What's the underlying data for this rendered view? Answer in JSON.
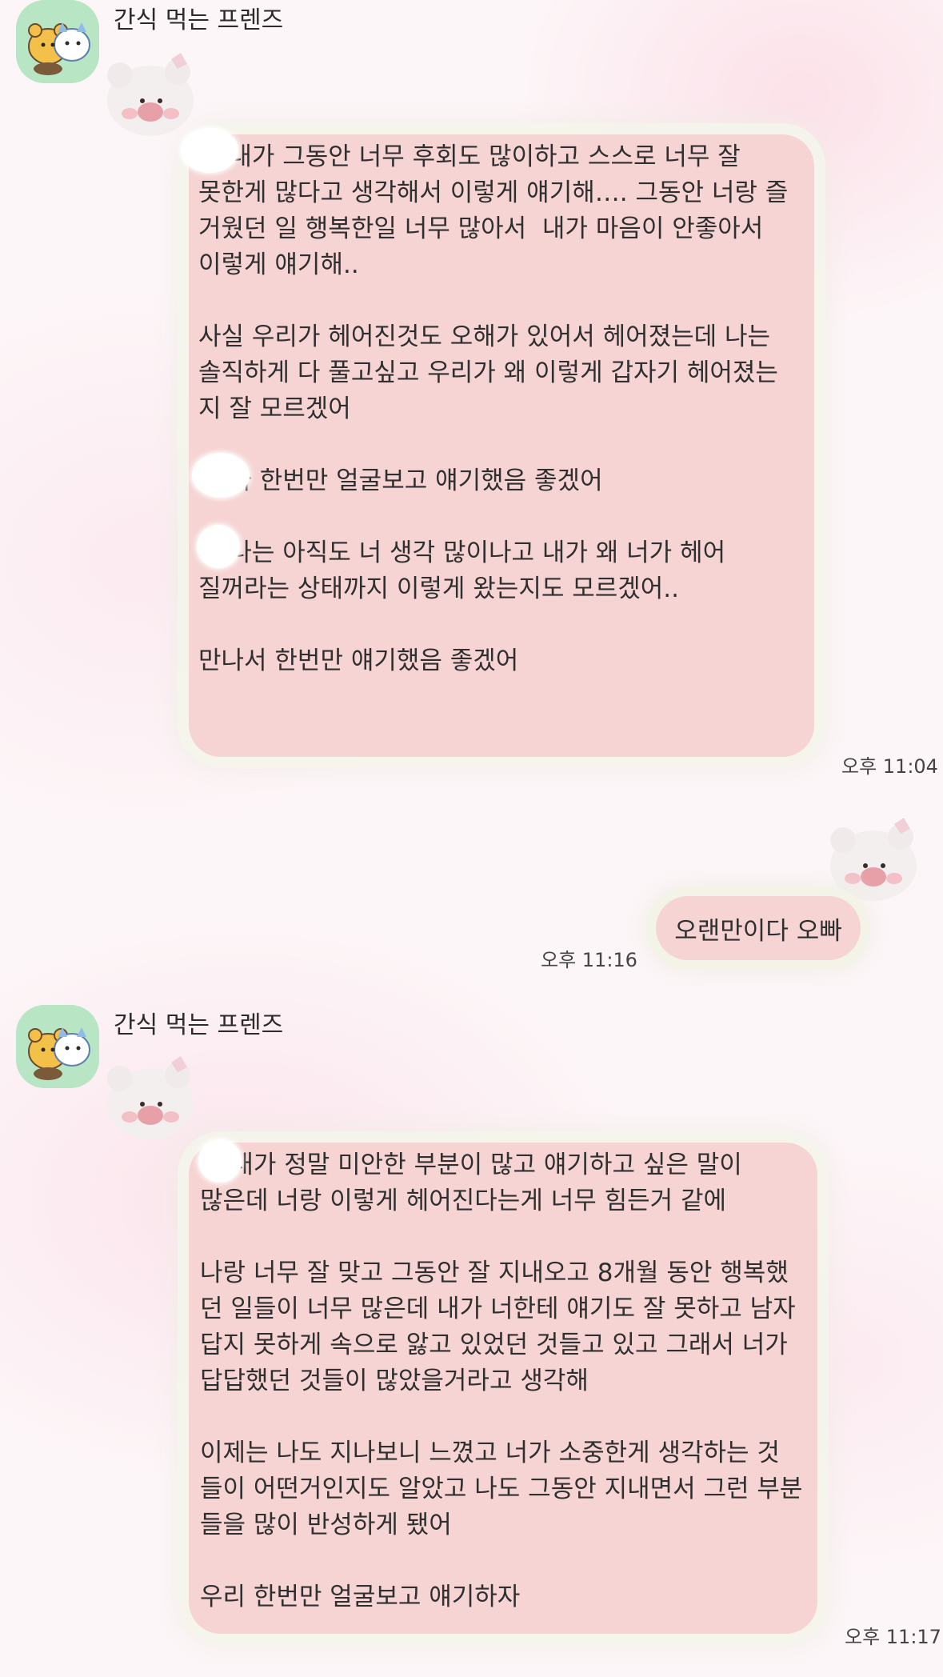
{
  "colors": {
    "bubble": "#f6d4d4",
    "avatar_bg": "#b8e6c4",
    "background": "#fdf6f8"
  },
  "messages": [
    {
      "sender": "간식 먹는 프렌즈",
      "text": "아 내가 그동안 너무 후회도 많이하고 스스로 너무 잘 못한게 많다고 생각해서 이렇게 얘기해…. 그동안 너랑 즐 거웠던 일 행복한일 너무 많아서  내가 마음이 안좋아서 이렇게 얘기해..\n\n사실 우리가 헤어진것도 오해가 있어서 헤어졌는데 나는 솔직하게 다 풀고싶고 우리가 왜 이렇게 갑자기 헤어졌는 지 잘 모르겠어\n\n아 나 한번만 얼굴보고 얘기했음 좋겠어\n\n아 나는 아직도 너 생각 많이나고 내가 왜 너가 헤어 질꺼라는 상태까지 이렇게 왔는지도 모르겠어..\n\n만나서 한번만 얘기했음 좋겠어",
      "time": "오후 11:04"
    },
    {
      "text": "오랜만이다 오빠",
      "time": "오후 11:16"
    },
    {
      "sender": "간식 먹는 프렌즈",
      "text": "아 내가 정말 미안한 부분이 많고 얘기하고 싶은 말이 많은데 너랑 이렇게 헤어진다는게 너무 힘든거 같에\n\n나랑 너무 잘 맞고 그동안 잘 지내오고 8개월 동안 행복했 던 일들이 너무 많은데 내가 너한테 얘기도 잘 못하고 남자 답지 못하게 속으로 앓고 있었던 것들고 있고 그래서 너가 답답했던 것들이 많았을거라고 생각해\n\n이제는 나도 지나보니 느꼈고 너가 소중한게 생각하는 것 들이 어떤거인지도 알았고 나도 그동안 지내면서 그런 부분 들을 많이 반성하게 됐어\n\n우리 한번만 얼굴보고 얘기하자",
      "time": "오후 11:17"
    }
  ]
}
